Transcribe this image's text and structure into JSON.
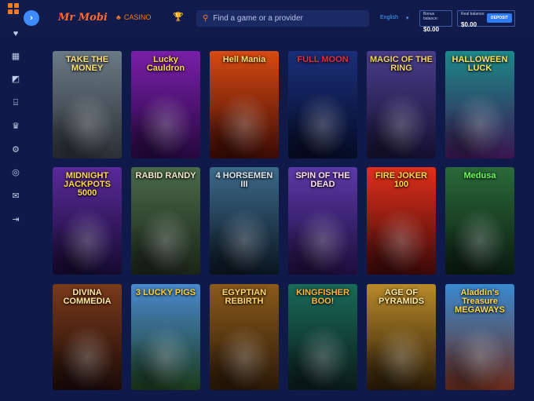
{
  "header": {
    "logo": "Mr Mobi",
    "casino_label": "CASINO",
    "search_placeholder": "Find a game or a provider",
    "language": "English",
    "bonus_label": "Bonus balance:",
    "bonus_amount": "$0.00",
    "real_label": "Real balance:",
    "real_amount": "$0.00",
    "deposit_label": "DEPOSIT"
  },
  "icons": {
    "menu": "grid-menu-icon",
    "expand": "chevron-right-icon",
    "casino": "cards-icon",
    "trophy": "trophy-icon",
    "search": "search-icon",
    "dropdown": "chevron-down-icon"
  },
  "sidebar": [
    "heart-icon",
    "slots-icon",
    "table-games-icon",
    "gift-icon",
    "trophy-icon",
    "settings-icon",
    "support-icon",
    "chat-icon",
    "logout-icon"
  ],
  "colors": {
    "accent": "#ff7a1a",
    "primary": "#2e7cf6",
    "background": "#0f1a4a"
  },
  "games": [
    {
      "title": "TAKE THE MONEY",
      "c1": "#6b7a86",
      "c2": "#2a2f35",
      "tc": "#ffe27a"
    },
    {
      "title": "Lucky Cauldron",
      "c1": "#7a1fa8",
      "c2": "#24083e",
      "tc": "#ffd84a"
    },
    {
      "title": "Hell Mania",
      "c1": "#d84a12",
      "c2": "#3a0a04",
      "tc": "#ffe06b"
    },
    {
      "title": "FULL MOON",
      "c1": "#1a2f7a",
      "c2": "#050b24",
      "tc": "#e4313b"
    },
    {
      "title": "MAGIC OF THE RING",
      "c1": "#4a3d8a",
      "c2": "#141030",
      "tc": "#f3d36a"
    },
    {
      "title": "HALLOWEEN LUCK",
      "c1": "#1c8a8a",
      "c2": "#3a1550",
      "tc": "#ffe45a"
    },
    {
      "title": "MIDNIGHT JACKPOTS 5000",
      "c1": "#5a2a9a",
      "c2": "#140a30",
      "tc": "#ffd84a"
    },
    {
      "title": "RABID RANDY",
      "c1": "#4a6a4a",
      "c2": "#1a2418",
      "tc": "#f0e6c8"
    },
    {
      "title": "4 HORSEMEN III",
      "c1": "#3d6a8a",
      "c2": "#0a1420",
      "tc": "#dfe8f0"
    },
    {
      "title": "SPIN OF THE DEAD",
      "c1": "#5a3aa8",
      "c2": "#1e0c3a",
      "tc": "#ffe0f0"
    },
    {
      "title": "FIRE JOKER 100",
      "c1": "#e0301a",
      "c2": "#3a0808",
      "tc": "#ffd94a"
    },
    {
      "title": "Medusa",
      "c1": "#2a6a3a",
      "c2": "#0a1a10",
      "tc": "#6bff5a"
    },
    {
      "title": "DIVINA COMMEDIA",
      "c1": "#7a3a1a",
      "c2": "#1a0a08",
      "tc": "#ffe6a0"
    },
    {
      "title": "3 LUCKY PIGS",
      "c1": "#4a8ad0",
      "c2": "#1a3a1a",
      "tc": "#ffd23a"
    },
    {
      "title": "EGYPTIAN REBIRTH",
      "c1": "#8a5a1a",
      "c2": "#2a1808",
      "tc": "#ffd86a"
    },
    {
      "title": "KINGFISHER BOO!",
      "c1": "#1a6a5a",
      "c2": "#0a1a18",
      "tc": "#ffb43a"
    },
    {
      "title": "AGE OF PYRAMIDS",
      "c1": "#b88a2a",
      "c2": "#2a1a06",
      "tc": "#ffe8a0"
    },
    {
      "title": "Aladdin's Treasure MEGAWAYS",
      "c1": "#3a8ad0",
      "c2": "#6a2a1a",
      "tc": "#ffd84a"
    }
  ]
}
